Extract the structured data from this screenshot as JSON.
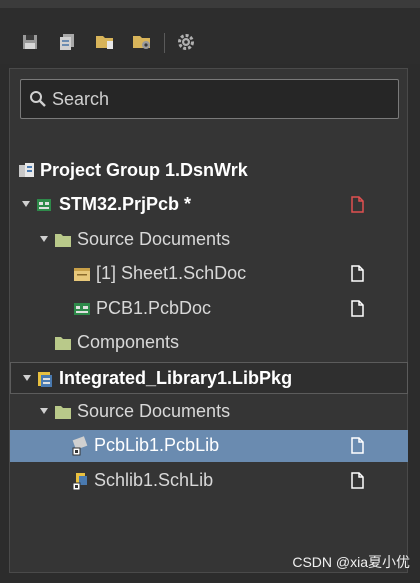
{
  "toolbar": {
    "buttons": [
      "save-icon",
      "save-all-icon",
      "open-folder-icon",
      "folder-settings-icon",
      "settings-icon"
    ]
  },
  "search": {
    "placeholder": "Search"
  },
  "tree": {
    "project_group": "Project Group 1.DsnWrk",
    "project_stm32": "STM32.PrjPcb *",
    "source_documents_1": "Source Documents",
    "sheet1": "[1] Sheet1.SchDoc",
    "pcb1": "PCB1.PcbDoc",
    "components": "Components",
    "integrated_library": "Integrated_Library1.LibPkg",
    "source_documents_2": "Source Documents",
    "pcblib1": "PcbLib1.PcbLib",
    "schlib1": "Schlib1.SchLib"
  },
  "colors": {
    "selected_row": "#6a8bb0",
    "modified_status": "#e05050",
    "folder": "#b9c98a"
  },
  "watermark": "CSDN @xia夏小优"
}
